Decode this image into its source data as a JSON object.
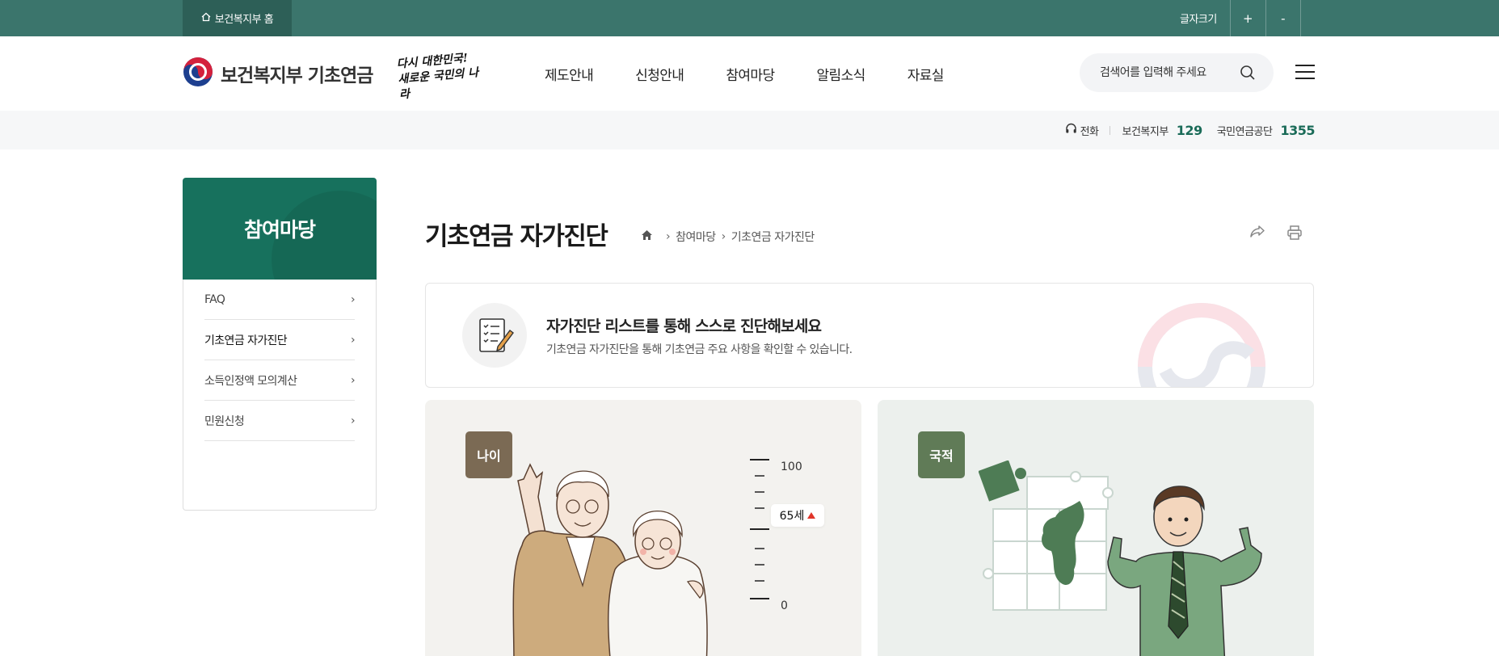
{
  "topbar": {
    "home_link": "보건복지부 홈",
    "fontsize_label": "글자크기",
    "increase_label": "+",
    "decrease_label": "-"
  },
  "header": {
    "logo_text": "보건복지부 기초연금",
    "slogan_line1": "다시 대한민국!",
    "slogan_line2": "새로운 국민의 나라",
    "nav": [
      "제도안내",
      "신청안내",
      "참여마당",
      "알림소식",
      "자료실"
    ],
    "search_placeholder": "검색어를 입력해 주세요"
  },
  "contact": {
    "phone_label": "전화",
    "org1": "보건복지부",
    "num1": "129",
    "org2": "국민연금공단",
    "num2": "1355"
  },
  "sidebar": {
    "title": "참여마당",
    "items": [
      {
        "label": "FAQ",
        "active": false
      },
      {
        "label": "기초연금 자가진단",
        "active": true
      },
      {
        "label": "소득인정액 모의계산",
        "active": false
      },
      {
        "label": "민원신청",
        "active": false
      }
    ]
  },
  "main": {
    "title": "기초연금 자가진단",
    "breadcrumb": [
      "참여마당",
      "기초연금 자가진단"
    ],
    "intro_title": "자가진단 리스트를 통해 스스로 진단해보세요",
    "intro_desc": "기초연금 자가진단을 통해 기초연금 주요 사항을 확인할 수 있습니다.",
    "cards": [
      {
        "badge": "나이",
        "scale_max": "100",
        "scale_min": "0",
        "age_value": "65세"
      },
      {
        "badge": "국적"
      }
    ]
  },
  "colors": {
    "topbar": "#3b756c",
    "brand_green": "#17715d",
    "accent_red": "#e0352a"
  }
}
